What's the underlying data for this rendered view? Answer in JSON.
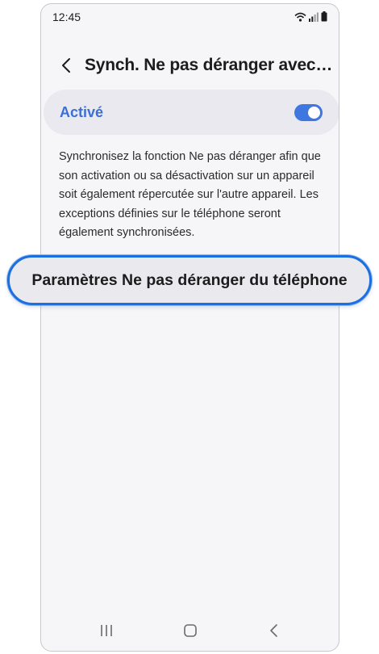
{
  "status_bar": {
    "time": "12:45",
    "icons": [
      "wifi-icon",
      "signal-icon",
      "battery-icon"
    ]
  },
  "header": {
    "title": "Synch. Ne pas déranger avec…",
    "back_icon": "chevron-left-icon"
  },
  "toggle": {
    "label": "Activé",
    "state": "on",
    "accent_color": "#3e77e0"
  },
  "description": "Synchronisez la fonction Ne pas déranger afin que son activation ou sa désactivation sur un appareil soit également répercutée sur l'autre appareil. Les exceptions définies sur le téléphone seront également synchronisées.",
  "settings_link": {
    "label": "Paramètres Ne pas déranger du téléphone",
    "highlight_color": "#1b6fe0"
  },
  "nav_bar": {
    "icons": [
      "recent-apps-icon",
      "home-icon",
      "back-icon"
    ]
  }
}
